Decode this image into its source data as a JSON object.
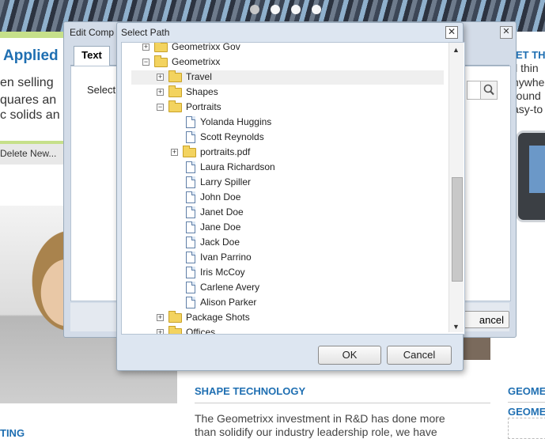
{
  "background": {
    "left_title": "Applied",
    "left_lines": [
      "en selling",
      "quares an",
      "c solids an"
    ],
    "left_toolbar": "Delete  New...",
    "right_title": "ET TH",
    "right_lines": [
      "ll thin",
      "nywhe",
      "round",
      "asy-to"
    ],
    "shape_heading": "SHAPE TECHNOLOGY",
    "shape_body": [
      "The Geometrixx investment in R&D has done more",
      "than solidify our industry leadership role, we have"
    ],
    "geo_heading_1": "GEOME",
    "geo_heading_2": "GEOME",
    "left_bottom_heading": "TING"
  },
  "edit_dialog": {
    "title": "Edit Comp",
    "tab_text": "Text",
    "select_label": "Select",
    "cancel_label": "ancel"
  },
  "path_dialog": {
    "title": "Select Path",
    "close_glyph": "✕",
    "tree": [
      {
        "label": "Geometrixx Gov",
        "type": "folder",
        "expander": "+",
        "level": 0
      },
      {
        "label": "Geometrixx",
        "type": "folder",
        "expander": "−",
        "level": 0
      },
      {
        "label": "Travel",
        "type": "folder",
        "expander": "+",
        "level": 1,
        "selected": true
      },
      {
        "label": "Shapes",
        "type": "folder",
        "expander": "+",
        "level": 1
      },
      {
        "label": "Portraits",
        "type": "folder",
        "expander": "−",
        "level": 1
      },
      {
        "label": "Yolanda Huggins",
        "type": "page",
        "level": 2
      },
      {
        "label": "Scott Reynolds",
        "type": "page",
        "level": 2
      },
      {
        "label": "portraits.pdf",
        "type": "folder",
        "expander": "+",
        "level": 2
      },
      {
        "label": "Laura Richardson",
        "type": "page",
        "level": 2
      },
      {
        "label": "Larry Spiller",
        "type": "page",
        "level": 2
      },
      {
        "label": "John Doe",
        "type": "page",
        "level": 2
      },
      {
        "label": "Janet Doe",
        "type": "page",
        "level": 2
      },
      {
        "label": "Jane Doe",
        "type": "page",
        "level": 2
      },
      {
        "label": "Jack Doe",
        "type": "page",
        "level": 2
      },
      {
        "label": "Ivan Parrino",
        "type": "page",
        "level": 2
      },
      {
        "label": "Iris McCoy",
        "type": "page",
        "level": 2
      },
      {
        "label": "Carlene Avery",
        "type": "page",
        "level": 2
      },
      {
        "label": "Alison Parker",
        "type": "page",
        "level": 2
      },
      {
        "label": "Package Shots",
        "type": "folder",
        "expander": "+",
        "level": 1
      },
      {
        "label": "Offices",
        "type": "folder",
        "expander": "+",
        "level": 1
      }
    ],
    "ok_label": "OK",
    "cancel_label": "Cancel"
  },
  "colors": {
    "link_blue": "#1f6fb2",
    "dialog_bg": "#dde6f1",
    "folder_yellow": "#f3d35f",
    "accent_green": "#c6e08a"
  }
}
